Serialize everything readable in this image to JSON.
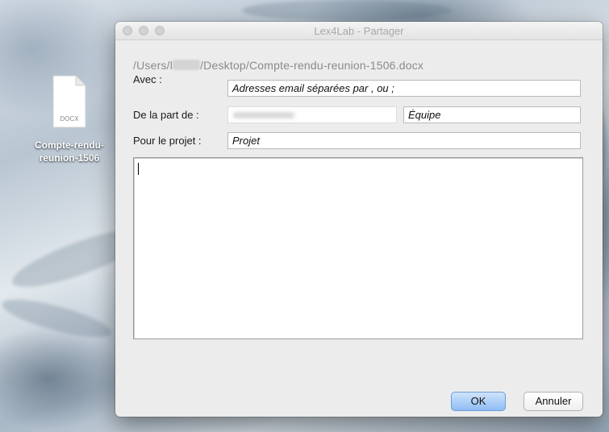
{
  "desktop": {
    "file_badge": "DOCX",
    "file_name": "Compte-rendu-\nreunion-1506"
  },
  "window": {
    "title": "Lex4Lab - Partager",
    "path_prefix": "/Users/l",
    "path_suffix": "/Desktop/Compte-rendu-reunion-1506.docx"
  },
  "form": {
    "avec_label": "Avec :",
    "avec_placeholder": "Adresses email séparées par , ou ;",
    "from_label": "De la part de :",
    "team_value": "Équipe",
    "project_label": "Pour le projet :",
    "project_value": "Projet",
    "message_value": ""
  },
  "buttons": {
    "ok_label": "OK",
    "cancel_label": "Annuler"
  },
  "colors": {
    "ok_button": "#8fbdf3",
    "window_background": "#ececec"
  }
}
